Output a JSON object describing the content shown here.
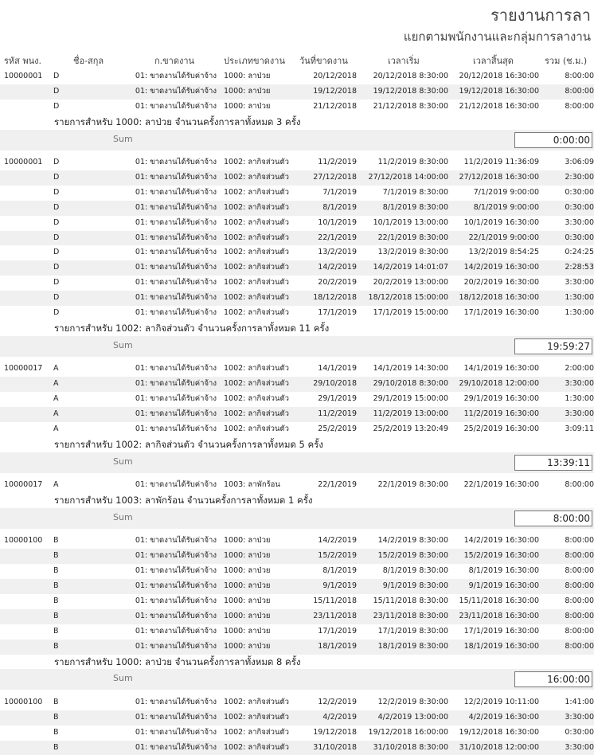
{
  "report": {
    "title": "รายงานการลา",
    "subtitle": "แยกตามพนักงานและกลุ่มการลางาน",
    "sum_label": "Sum",
    "columns": [
      "รหัส พนง.",
      "ชื่อ-สกุล",
      "ก.ขาดงาน",
      "ประเภทขาดงาน",
      "วันที่ขาดงาน",
      "เวลาเริ่ม",
      "เวลาสิ้นสุด",
      "รวม (ช.ม.)"
    ],
    "groups": [
      {
        "rows": [
          [
            "10000001",
            "D",
            "01: ขาดงานได้รับค่าจ้าง",
            "1000: ลาป่วย",
            "20/12/2018",
            "20/12/2018 8:30:00",
            "20/12/2018 16:30:00",
            "8:00:00"
          ],
          [
            "",
            "D",
            "01: ขาดงานได้รับค่าจ้าง",
            "1000: ลาป่วย",
            "19/12/2018",
            "19/12/2018 8:30:00",
            "19/12/2018 16:30:00",
            "8:00:00"
          ],
          [
            "",
            "D",
            "01: ขาดงานได้รับค่าจ้าง",
            "1000: ลาป่วย",
            "21/12/2018",
            "21/12/2018 8:30:00",
            "21/12/2018 16:30:00",
            "8:00:00"
          ]
        ],
        "summary": "รายการสำหรับ 1000: ลาป่วย จำนวนครั้งการลาทั้งหมด 3 ครั้ง",
        "sum": "0:00:00"
      },
      {
        "rows": [
          [
            "10000001",
            "D",
            "01: ขาดงานได้รับค่าจ้าง",
            "1002: ลากิจส่วนตัว",
            "11/2/2019",
            "11/2/2019 8:30:00",
            "11/2/2019 11:36:09",
            "3:06:09"
          ],
          [
            "",
            "D",
            "01: ขาดงานได้รับค่าจ้าง",
            "1002: ลากิจส่วนตัว",
            "27/12/2018",
            "27/12/2018 14:00:00",
            "27/12/2018 16:30:00",
            "2:30:00"
          ],
          [
            "",
            "D",
            "01: ขาดงานได้รับค่าจ้าง",
            "1002: ลากิจส่วนตัว",
            "7/1/2019",
            "7/1/2019 8:30:00",
            "7/1/2019 9:00:00",
            "0:30:00"
          ],
          [
            "",
            "D",
            "01: ขาดงานได้รับค่าจ้าง",
            "1002: ลากิจส่วนตัว",
            "8/1/2019",
            "8/1/2019 8:30:00",
            "8/1/2019 9:00:00",
            "0:30:00"
          ],
          [
            "",
            "D",
            "01: ขาดงานได้รับค่าจ้าง",
            "1002: ลากิจส่วนตัว",
            "10/1/2019",
            "10/1/2019 13:00:00",
            "10/1/2019 16:30:00",
            "3:30:00"
          ],
          [
            "",
            "D",
            "01: ขาดงานได้รับค่าจ้าง",
            "1002: ลากิจส่วนตัว",
            "22/1/2019",
            "22/1/2019 8:30:00",
            "22/1/2019 9:00:00",
            "0:30:00"
          ],
          [
            "",
            "D",
            "01: ขาดงานได้รับค่าจ้าง",
            "1002: ลากิจส่วนตัว",
            "13/2/2019",
            "13/2/2019 8:30:00",
            "13/2/2019 8:54:25",
            "0:24:25"
          ],
          [
            "",
            "D",
            "01: ขาดงานได้รับค่าจ้าง",
            "1002: ลากิจส่วนตัว",
            "14/2/2019",
            "14/2/2019 14:01:07",
            "14/2/2019 16:30:00",
            "2:28:53"
          ],
          [
            "",
            "D",
            "01: ขาดงานได้รับค่าจ้าง",
            "1002: ลากิจส่วนตัว",
            "20/2/2019",
            "20/2/2019 13:00:00",
            "20/2/2019 16:30:00",
            "3:30:00"
          ],
          [
            "",
            "D",
            "01: ขาดงานได้รับค่าจ้าง",
            "1002: ลากิจส่วนตัว",
            "18/12/2018",
            "18/12/2018 15:00:00",
            "18/12/2018 16:30:00",
            "1:30:00"
          ],
          [
            "",
            "D",
            "01: ขาดงานได้รับค่าจ้าง",
            "1002: ลากิจส่วนตัว",
            "17/1/2019",
            "17/1/2019 15:00:00",
            "17/1/2019 16:30:00",
            "1:30:00"
          ]
        ],
        "summary": "รายการสำหรับ 1002: ลากิจส่วนตัว จำนวนครั้งการลาทั้งหมด 11 ครั้ง",
        "sum": "19:59:27"
      },
      {
        "rows": [
          [
            "10000017",
            "A",
            "01: ขาดงานได้รับค่าจ้าง",
            "1002: ลากิจส่วนตัว",
            "14/1/2019",
            "14/1/2019 14:30:00",
            "14/1/2019 16:30:00",
            "2:00:00"
          ],
          [
            "",
            "A",
            "01: ขาดงานได้รับค่าจ้าง",
            "1002: ลากิจส่วนตัว",
            "29/10/2018",
            "29/10/2018 8:30:00",
            "29/10/2018 12:00:00",
            "3:30:00"
          ],
          [
            "",
            "A",
            "01: ขาดงานได้รับค่าจ้าง",
            "1002: ลากิจส่วนตัว",
            "29/1/2019",
            "29/1/2019 15:00:00",
            "29/1/2019 16:30:00",
            "1:30:00"
          ],
          [
            "",
            "A",
            "01: ขาดงานได้รับค่าจ้าง",
            "1002: ลากิจส่วนตัว",
            "11/2/2019",
            "11/2/2019 13:00:00",
            "11/2/2019 16:30:00",
            "3:30:00"
          ],
          [
            "",
            "A",
            "01: ขาดงานได้รับค่าจ้าง",
            "1002: ลากิจส่วนตัว",
            "25/2/2019",
            "25/2/2019 13:20:49",
            "25/2/2019 16:30:00",
            "3:09:11"
          ]
        ],
        "summary": "รายการสำหรับ 1002: ลากิจส่วนตัว จำนวนครั้งการลาทั้งหมด 5 ครั้ง",
        "sum": "13:39:11"
      },
      {
        "rows": [
          [
            "10000017",
            "A",
            "01: ขาดงานได้รับค่าจ้าง",
            "1003: ลาพักร้อน",
            "22/1/2019",
            "22/1/2019 8:30:00",
            "22/1/2019 16:30:00",
            "8:00:00"
          ]
        ],
        "summary": "รายการสำหรับ 1003: ลาพักร้อน จำนวนครั้งการลาทั้งหมด 1 ครั้ง",
        "sum": "8:00:00"
      },
      {
        "rows": [
          [
            "10000100",
            "B",
            "01: ขาดงานได้รับค่าจ้าง",
            "1000: ลาป่วย",
            "14/2/2019",
            "14/2/2019 8:30:00",
            "14/2/2019 16:30:00",
            "8:00:00"
          ],
          [
            "",
            "B",
            "01: ขาดงานได้รับค่าจ้าง",
            "1000: ลาป่วย",
            "15/2/2019",
            "15/2/2019 8:30:00",
            "15/2/2019 16:30:00",
            "8:00:00"
          ],
          [
            "",
            "B",
            "01: ขาดงานได้รับค่าจ้าง",
            "1000: ลาป่วย",
            "8/1/2019",
            "8/1/2019 8:30:00",
            "8/1/2019 16:30:00",
            "8:00:00"
          ],
          [
            "",
            "B",
            "01: ขาดงานได้รับค่าจ้าง",
            "1000: ลาป่วย",
            "9/1/2019",
            "9/1/2019 8:30:00",
            "9/1/2019 16:30:00",
            "8:00:00"
          ],
          [
            "",
            "B",
            "01: ขาดงานได้รับค่าจ้าง",
            "1000: ลาป่วย",
            "15/11/2018",
            "15/11/2018 8:30:00",
            "15/11/2018 16:30:00",
            "8:00:00"
          ],
          [
            "",
            "B",
            "01: ขาดงานได้รับค่าจ้าง",
            "1000: ลาป่วย",
            "23/11/2018",
            "23/11/2018 8:30:00",
            "23/11/2018 16:30:00",
            "8:00:00"
          ],
          [
            "",
            "B",
            "01: ขาดงานได้รับค่าจ้าง",
            "1000: ลาป่วย",
            "17/1/2019",
            "17/1/2019 8:30:00",
            "17/1/2019 16:30:00",
            "8:00:00"
          ],
          [
            "",
            "B",
            "01: ขาดงานได้รับค่าจ้าง",
            "1000: ลาป่วย",
            "18/1/2019",
            "18/1/2019 8:30:00",
            "18/1/2019 16:30:00",
            "8:00:00"
          ]
        ],
        "summary": "รายการสำหรับ 1000: ลาป่วย จำนวนครั้งการลาทั้งหมด 8 ครั้ง",
        "sum": "16:00:00"
      },
      {
        "rows": [
          [
            "10000100",
            "B",
            "01: ขาดงานได้รับค่าจ้าง",
            "1002: ลากิจส่วนตัว",
            "12/2/2019",
            "12/2/2019 8:30:00",
            "12/2/2019 10:11:00",
            "1:41:00"
          ],
          [
            "",
            "B",
            "01: ขาดงานได้รับค่าจ้าง",
            "1002: ลากิจส่วนตัว",
            "4/2/2019",
            "4/2/2019 13:00:00",
            "4/2/2019 16:30:00",
            "3:30:00"
          ],
          [
            "",
            "B",
            "01: ขาดงานได้รับค่าจ้าง",
            "1002: ลากิจส่วนตัว",
            "19/12/2018",
            "19/12/2018 16:00:00",
            "19/12/2018 16:30:00",
            "0:30:00"
          ],
          [
            "",
            "B",
            "01: ขาดงานได้รับค่าจ้าง",
            "1002: ลากิจส่วนตัว",
            "31/10/2018",
            "31/10/2018 8:30:00",
            "31/10/2018 12:00:00",
            "3:30:00"
          ]
        ]
      }
    ]
  }
}
